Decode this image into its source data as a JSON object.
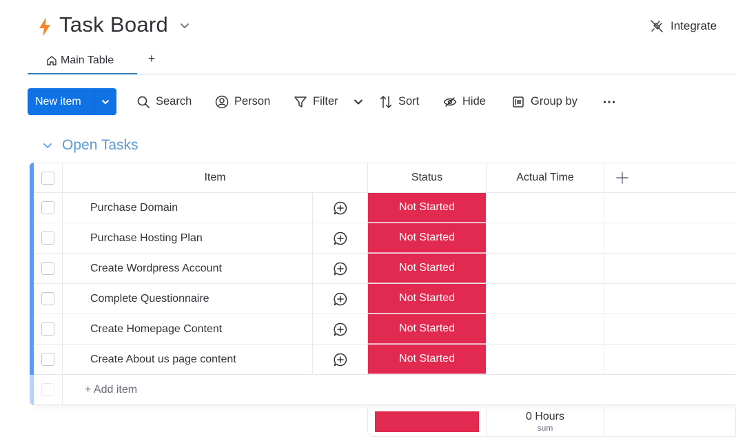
{
  "header": {
    "title": "Task Board",
    "logo_icon": "lightning-bolt-icon",
    "integrate_label": "Integrate",
    "brand_color": "#f6862a"
  },
  "tabs": [
    {
      "label": "Main Table",
      "icon": "home-icon",
      "active": true
    }
  ],
  "toolbar": {
    "new_item_label": "New item",
    "search_label": "Search",
    "person_label": "Person",
    "filter_label": "Filter",
    "sort_label": "Sort",
    "hide_label": "Hide",
    "group_by_label": "Group by",
    "more_icon": "ellipsis-icon",
    "primary_color": "#0f73e6"
  },
  "group": {
    "title": "Open Tasks",
    "color": "#579bfc",
    "columns": {
      "item": "Item",
      "status": "Status",
      "actual_time": "Actual Time"
    },
    "rows": [
      {
        "name": "Purchase Domain",
        "status": "Not Started",
        "actual_time": ""
      },
      {
        "name": "Purchase Hosting Plan",
        "status": "Not Started",
        "actual_time": ""
      },
      {
        "name": "Create Wordpress Account",
        "status": "Not Started",
        "actual_time": ""
      },
      {
        "name": "Complete Questionnaire",
        "status": "Not Started",
        "actual_time": ""
      },
      {
        "name": "Create Homepage Content",
        "status": "Not Started",
        "actual_time": ""
      },
      {
        "name": "Create About us page content",
        "status": "Not Started",
        "actual_time": ""
      }
    ],
    "add_item_label": "+ Add item",
    "status_color": "#e2294f",
    "summary": {
      "time_value": "0 Hours",
      "time_function": "sum"
    }
  }
}
